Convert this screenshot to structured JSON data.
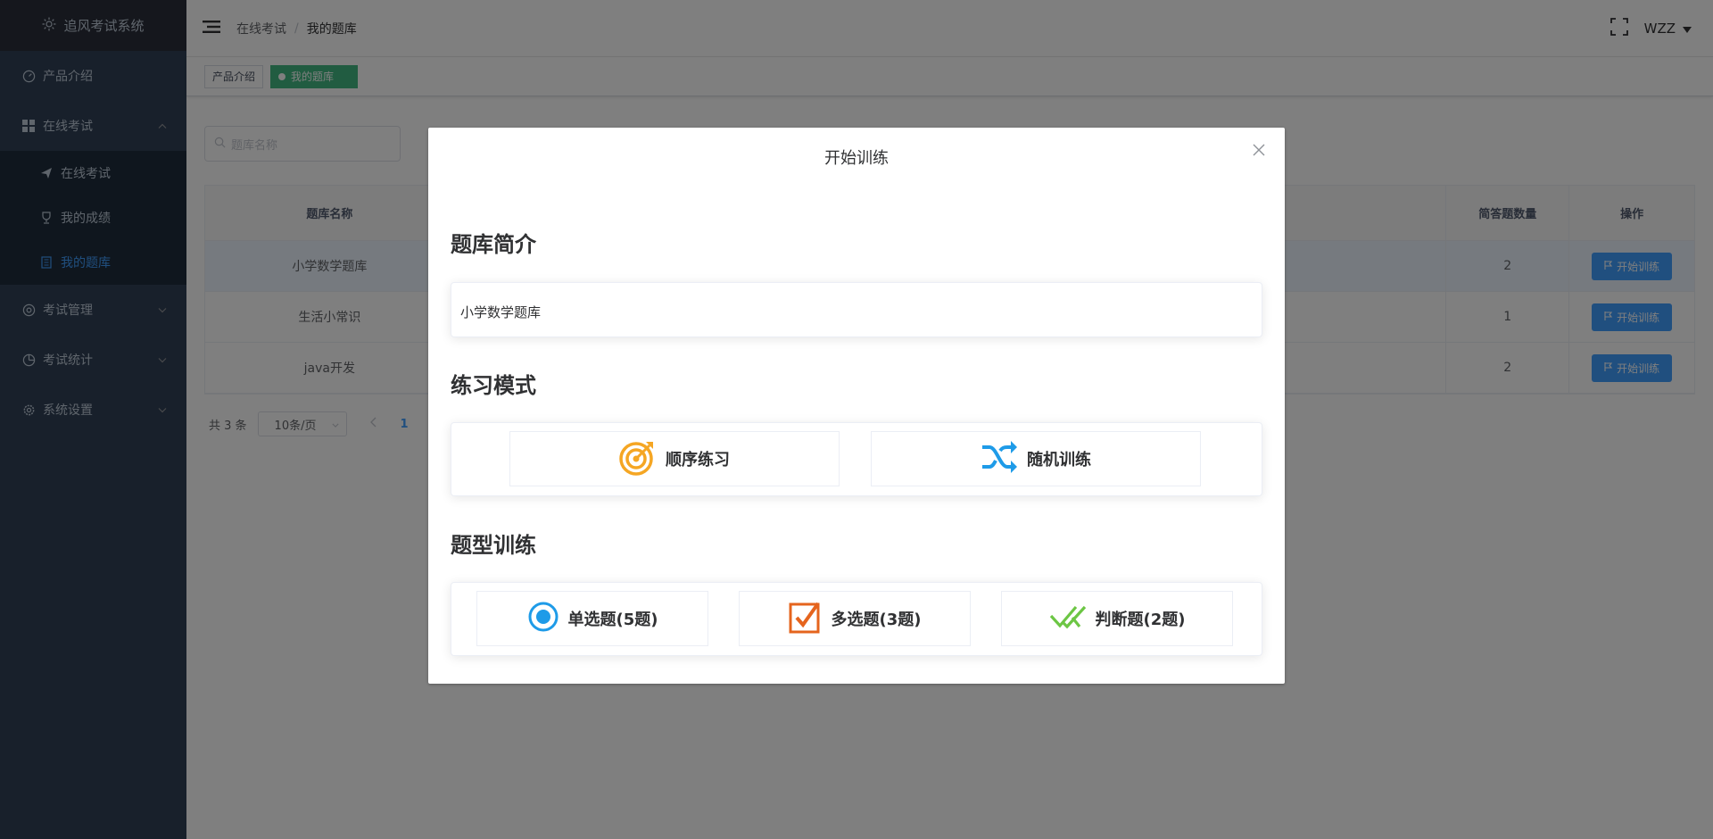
{
  "app": {
    "title": "追风考试系统"
  },
  "sidebar": {
    "items": [
      {
        "label": "产品介绍",
        "icon": "dashboard-icon"
      },
      {
        "label": "在线考试",
        "icon": "grid-icon",
        "expanded": true,
        "children": [
          {
            "label": "在线考试",
            "icon": "paper-plane-icon"
          },
          {
            "label": "我的成绩",
            "icon": "trophy-icon"
          },
          {
            "label": "我的题库",
            "icon": "book-icon",
            "active": true
          }
        ]
      },
      {
        "label": "考试管理",
        "icon": "settings-icon"
      },
      {
        "label": "考试统计",
        "icon": "pie-chart-icon"
      },
      {
        "label": "系统设置",
        "icon": "gear-icon"
      }
    ]
  },
  "navbar": {
    "breadcrumb": [
      "在线考试",
      "我的题库"
    ],
    "user": "WZZ"
  },
  "tags": [
    {
      "label": "产品介绍"
    },
    {
      "label": "我的题库",
      "active": true
    }
  ],
  "search": {
    "placeholder": "题库名称"
  },
  "table": {
    "headers": [
      "题库名称",
      "",
      "简答题数量",
      "操作"
    ],
    "rows": [
      {
        "name": "小学数学题库",
        "count": "2",
        "action": "开始训练"
      },
      {
        "name": "生活小常识",
        "count": "1",
        "action": "开始训练"
      },
      {
        "name": "java开发",
        "count": "2",
        "action": "开始训练"
      }
    ]
  },
  "pagination": {
    "total": "共 3 条",
    "page_size": "10条/页",
    "current": "1"
  },
  "dialog": {
    "title": "开始训练",
    "intro_title": "题库简介",
    "intro_text": "小学数学题库",
    "mode_title": "练习模式",
    "modes": [
      {
        "label": "顺序练习"
      },
      {
        "label": "随机训练"
      }
    ],
    "type_title": "题型训练",
    "types": [
      {
        "label": "单选题(5题)"
      },
      {
        "label": "多选题(3题)"
      },
      {
        "label": "判断题(2题)"
      }
    ]
  },
  "colors": {
    "sidebar_bg": "#304156",
    "accent": "#409eff",
    "tag_active": "#42b983",
    "orange": "#f5a623",
    "radio_blue": "#1e9be8",
    "check_orange": "#e5641d",
    "judge_green": "#6cc644"
  }
}
